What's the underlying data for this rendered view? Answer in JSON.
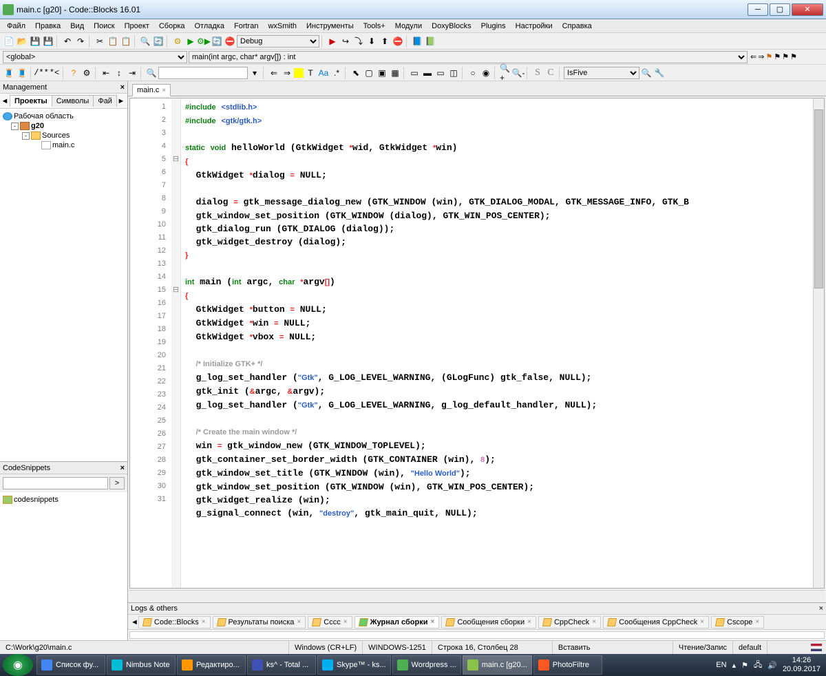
{
  "window": {
    "title": "main.c [g20] - Code::Blocks 16.01"
  },
  "menu": [
    "Файл",
    "Правка",
    "Вид",
    "Поиск",
    "Проект",
    "Сборка",
    "Отладка",
    "Fortran",
    "wxSmith",
    "Инструменты",
    "Tools+",
    "Модули",
    "DoxyBlocks",
    "Plugins",
    "Настройки",
    "Справка"
  ],
  "toolbar": {
    "build_target": "Debug",
    "symbol_combo": "IsFive"
  },
  "nav": {
    "scope": "<global>",
    "func": "main(int argc, char* argv[]) : int"
  },
  "management": {
    "title": "Management",
    "tabs": [
      "Проекты",
      "Символы",
      "Фай"
    ],
    "active_tab": 0,
    "tree": {
      "workspace": "Рабочая область",
      "project": "g20",
      "sources": "Sources",
      "file": "main.c"
    }
  },
  "snippets": {
    "title": "CodeSnippets",
    "root": "codesnippets"
  },
  "open_file": {
    "name": "main.c"
  },
  "code_lines": [
    {
      "n": 1,
      "h": "<span class='kw'>#include</span> <span class='qt'>&lt;stdlib.h&gt;</span>"
    },
    {
      "n": 2,
      "h": "<span class='kw'>#include</span> <span class='qt'>&lt;gtk/gtk.h&gt;</span>"
    },
    {
      "n": 3,
      "h": ""
    },
    {
      "n": 4,
      "h": "<span class='kw'>static</span> <span class='kw'>void</span> helloWorld (GtkWidget <span class='op'>*</span>wid, GtkWidget <span class='op'>*</span>win)"
    },
    {
      "n": 5,
      "h": "<span class='op'>{</span>",
      "fold": "⊟"
    },
    {
      "n": 6,
      "h": "  GtkWidget <span class='op'>*</span>dialog <span class='op'>=</span> NULL;"
    },
    {
      "n": 7,
      "h": ""
    },
    {
      "n": 8,
      "h": "  dialog <span class='op'>=</span> gtk_message_dialog_new (GTK_WINDOW (win), GTK_DIALOG_MODAL, GTK_MESSAGE_INFO, GTK_B"
    },
    {
      "n": 9,
      "h": "  gtk_window_set_position (GTK_WINDOW (dialog), GTK_WIN_POS_CENTER);"
    },
    {
      "n": 10,
      "h": "  gtk_dialog_run (GTK_DIALOG (dialog));"
    },
    {
      "n": 11,
      "h": "  gtk_widget_destroy (dialog);"
    },
    {
      "n": 12,
      "h": "<span class='op'>}</span>"
    },
    {
      "n": 13,
      "h": ""
    },
    {
      "n": 14,
      "h": "<span class='kw'>int</span> main (<span class='kw'>int</span> argc, <span class='kw'>char</span> <span class='op'>*</span>argv<span class='op'>[]</span>)"
    },
    {
      "n": 15,
      "h": "<span class='op'>{</span>",
      "fold": "⊟"
    },
    {
      "n": 16,
      "h": "  GtkWidget <span class='op'>*</span>button <span class='op'>=</span> NULL;"
    },
    {
      "n": 17,
      "h": "  GtkWidget <span class='op'>*</span>win <span class='op'>=</span> NULL;"
    },
    {
      "n": 18,
      "h": "  GtkWidget <span class='op'>*</span>vbox <span class='op'>=</span> NULL;"
    },
    {
      "n": 19,
      "h": ""
    },
    {
      "n": 20,
      "h": "  <span class='cmt'>/* Initialize GTK+ */</span>"
    },
    {
      "n": 21,
      "h": "  g_log_set_handler (<span class='str'>\"Gtk\"</span>, G_LOG_LEVEL_WARNING, (GLogFunc) gtk_false, NULL);"
    },
    {
      "n": 22,
      "h": "  gtk_init (<span class='op'>&amp;</span>argc, <span class='op'>&amp;</span>argv);"
    },
    {
      "n": 23,
      "h": "  g_log_set_handler (<span class='str'>\"Gtk\"</span>, G_LOG_LEVEL_WARNING, g_log_default_handler, NULL);"
    },
    {
      "n": 24,
      "h": ""
    },
    {
      "n": 25,
      "h": "  <span class='cmt'>/* Create the main window */</span>"
    },
    {
      "n": 26,
      "h": "  win <span class='op'>=</span> gtk_window_new (GTK_WINDOW_TOPLEVEL);"
    },
    {
      "n": 27,
      "h": "  gtk_container_set_border_width (GTK_CONTAINER (win), <span class='num'>8</span>);"
    },
    {
      "n": 28,
      "h": "  gtk_window_set_title (GTK_WINDOW (win), <span class='str'>\"Hello World\"</span>);"
    },
    {
      "n": 29,
      "h": "  gtk_window_set_position (GTK_WINDOW (win), GTK_WIN_POS_CENTER);"
    },
    {
      "n": 30,
      "h": "  gtk_widget_realize (win);"
    },
    {
      "n": 31,
      "h": "  g_signal_connect (win, <span class='str'>\"destroy\"</span>, gtk_main_quit, NULL);"
    }
  ],
  "logs": {
    "title": "Logs & others",
    "tabs": [
      "Code::Blocks",
      "Результаты поиска",
      "Cccc",
      "Журнал сборки",
      "Сообщения сборки",
      "CppCheck",
      "Сообщения CppCheck",
      "Cscope"
    ],
    "active": 3
  },
  "status": {
    "path": "C:\\Work\\g20\\main.c",
    "eol": "Windows (CR+LF)",
    "enc": "WINDOWS-1251",
    "pos": "Строка 16, Столбец 28",
    "ins": "Вставить",
    "rw": "Чтение/Запис",
    "default": "default"
  },
  "taskbar": {
    "items": [
      {
        "label": "Список фу...",
        "color": "#4285f4"
      },
      {
        "label": "Nimbus Note",
        "color": "#00bcd4"
      },
      {
        "label": "Редактиро...",
        "color": "#ff9800"
      },
      {
        "label": "ks^ - Total ...",
        "color": "#3f51b5"
      },
      {
        "label": "Skype™ - ks...",
        "color": "#00aff0"
      },
      {
        "label": "Wordpress ...",
        "color": "#4caf50"
      },
      {
        "label": "main.c [g20...",
        "color": "#8bc34a",
        "active": true
      },
      {
        "label": "PhotoFiltre",
        "color": "#ff5722"
      }
    ],
    "lang": "EN",
    "time": "14:26",
    "date": "20.09.2017"
  }
}
